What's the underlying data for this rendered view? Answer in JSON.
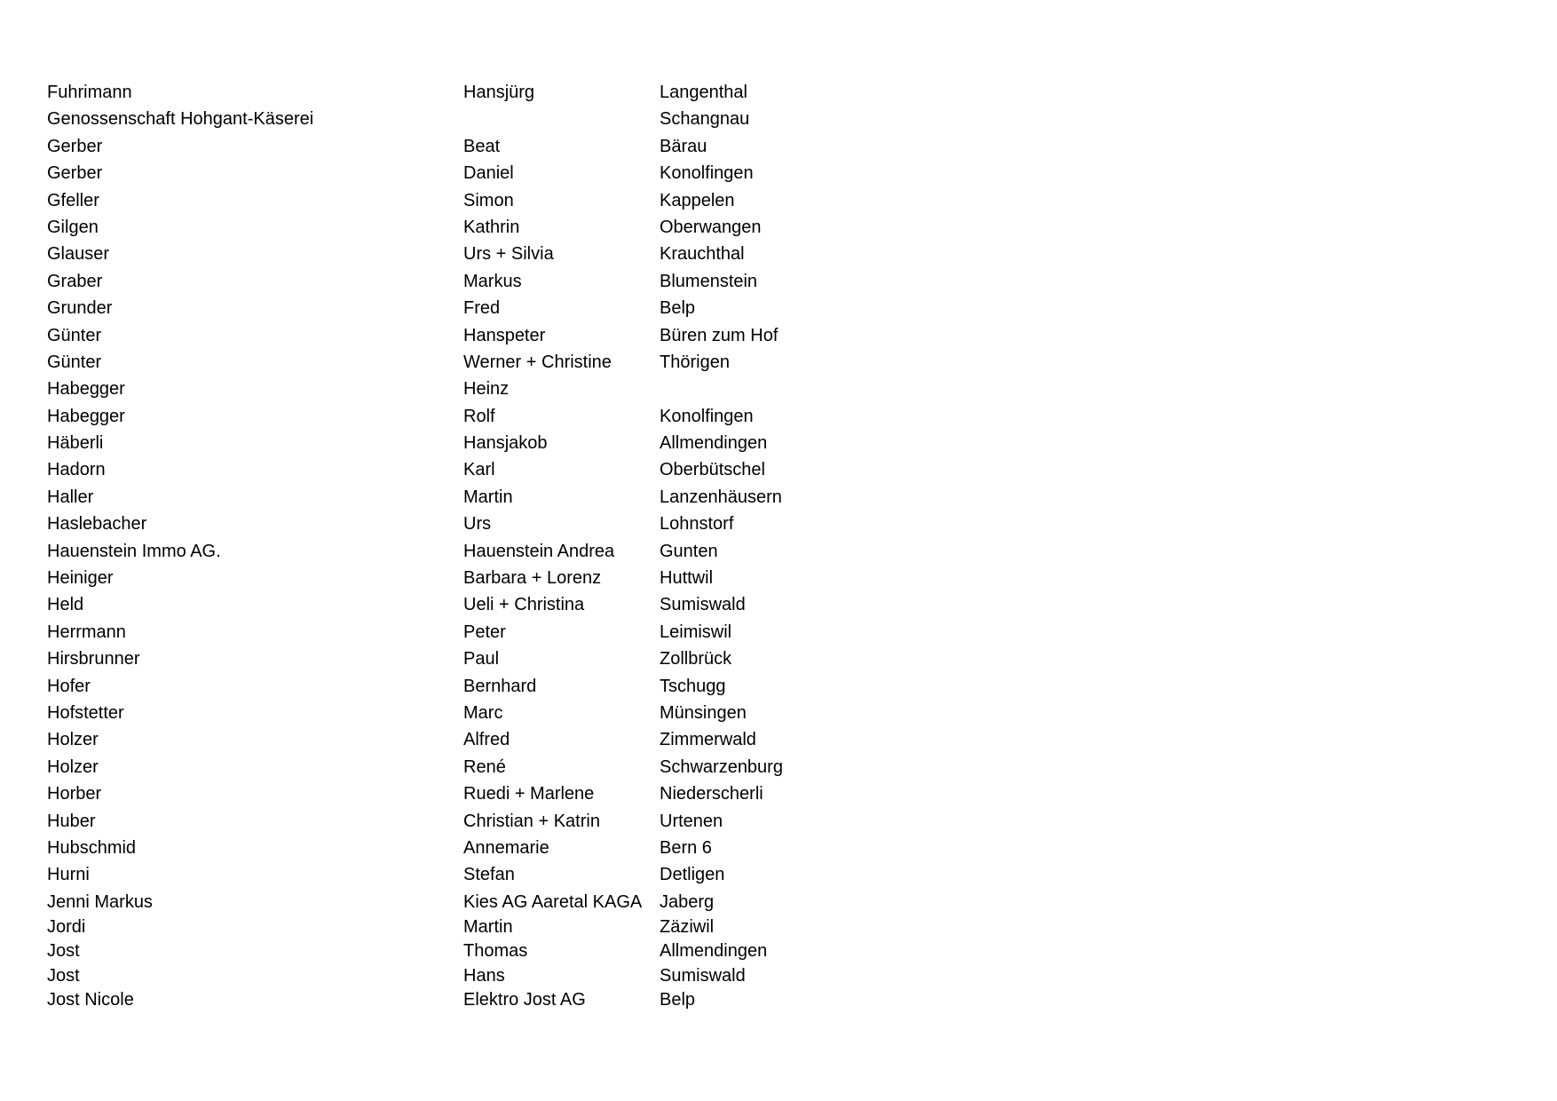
{
  "rows": [
    {
      "last": "Fuhrimann",
      "first": "Hansjürg",
      "city": "Langenthal"
    },
    {
      "last": "Genossenschaft Hohgant-Käserei",
      "first": "",
      "city": "Schangnau"
    },
    {
      "last": "Gerber",
      "first": "Beat",
      "city": "Bärau"
    },
    {
      "last": "Gerber",
      "first": "Daniel",
      "city": "Konolfingen"
    },
    {
      "last": "Gfeller",
      "first": "Simon",
      "city": "Kappelen"
    },
    {
      "last": "Gilgen",
      "first": "Kathrin",
      "city": "Oberwangen"
    },
    {
      "last": "Glauser",
      "first": "Urs + Silvia",
      "city": "Krauchthal"
    },
    {
      "last": "Graber",
      "first": "Markus",
      "city": "Blumenstein"
    },
    {
      "last": "Grunder",
      "first": "Fred",
      "city": "Belp"
    },
    {
      "last": "Günter",
      "first": "Hanspeter",
      "city": "Büren zum Hof"
    },
    {
      "last": "Günter",
      "first": "Werner + Christine",
      "city": "Thörigen"
    },
    {
      "last": "Habegger",
      "first": "Heinz",
      "city": ""
    },
    {
      "last": "Habegger",
      "first": "Rolf",
      "city": "Konolfingen"
    },
    {
      "last": "Häberli",
      "first": "Hansjakob",
      "city": "Allmendingen"
    },
    {
      "last": "Hadorn",
      "first": "Karl",
      "city": "Oberbütschel"
    },
    {
      "last": "Haller",
      "first": "Martin",
      "city": "Lanzenhäusern"
    },
    {
      "last": "Haslebacher",
      "first": "Urs",
      "city": "Lohnstorf"
    },
    {
      "last": "Hauenstein Immo AG.",
      "first": "Hauenstein Andrea",
      "city": "Gunten"
    },
    {
      "last": "Heiniger",
      "first": "Barbara + Lorenz",
      "city": "Huttwil"
    },
    {
      "last": "Held",
      "first": "Ueli + Christina",
      "city": "Sumiswald"
    },
    {
      "last": "Herrmann",
      "first": "Peter",
      "city": "Leimiswil"
    },
    {
      "last": "Hirsbrunner",
      "first": "Paul",
      "city": "Zollbrück"
    },
    {
      "last": "Hofer",
      "first": "Bernhard",
      "city": "Tschugg"
    },
    {
      "last": "Hofstetter",
      "first": "Marc",
      "city": "Münsingen"
    },
    {
      "last": "Holzer",
      "first": "Alfred",
      "city": "Zimmerwald"
    },
    {
      "last": "Holzer",
      "first": "René",
      "city": "Schwarzenburg"
    },
    {
      "last": "Horber",
      "first": "Ruedi + Marlene",
      "city": "Niederscherli"
    },
    {
      "last": "Huber",
      "first": "Christian + Katrin",
      "city": "Urtenen"
    },
    {
      "last": "Hubschmid",
      "first": "Annemarie",
      "city": "Bern 6"
    },
    {
      "last": "Hurni",
      "first": "Stefan",
      "city": "Detligen"
    },
    {
      "last": "Jenni Markus",
      "first": "Kies AG Aaretal KAGA",
      "city": "Jaberg"
    },
    {
      "last": "Jordi",
      "first": "Martin",
      "city": "Zäziwil"
    },
    {
      "last": "Jost",
      "first": "Thomas",
      "city": "Allmendingen"
    },
    {
      "last": "Jost",
      "first": "Hans",
      "city": "Sumiswald"
    },
    {
      "last": "Jost Nicole",
      "first": "Elektro Jost AG",
      "city": "Belp"
    }
  ]
}
